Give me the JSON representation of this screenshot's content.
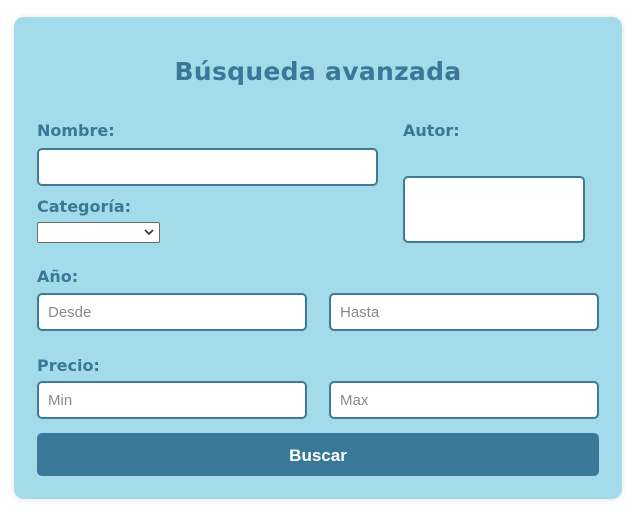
{
  "form": {
    "title": "Búsqueda avanzada",
    "nombre": {
      "label": "Nombre:",
      "value": ""
    },
    "autor": {
      "label": "Autor:",
      "value": ""
    },
    "categoria": {
      "label": "Categoría:",
      "selected": ""
    },
    "anio": {
      "label": "Año:",
      "desde_placeholder": "Desde",
      "hasta_placeholder": "Hasta"
    },
    "precio": {
      "label": "Precio:",
      "min_placeholder": "Min",
      "max_placeholder": "Max"
    },
    "submit_label": "Buscar"
  },
  "colors": {
    "card_background": "#a3dbea",
    "accent": "#3a7898",
    "field_border": "#3d7b97"
  }
}
